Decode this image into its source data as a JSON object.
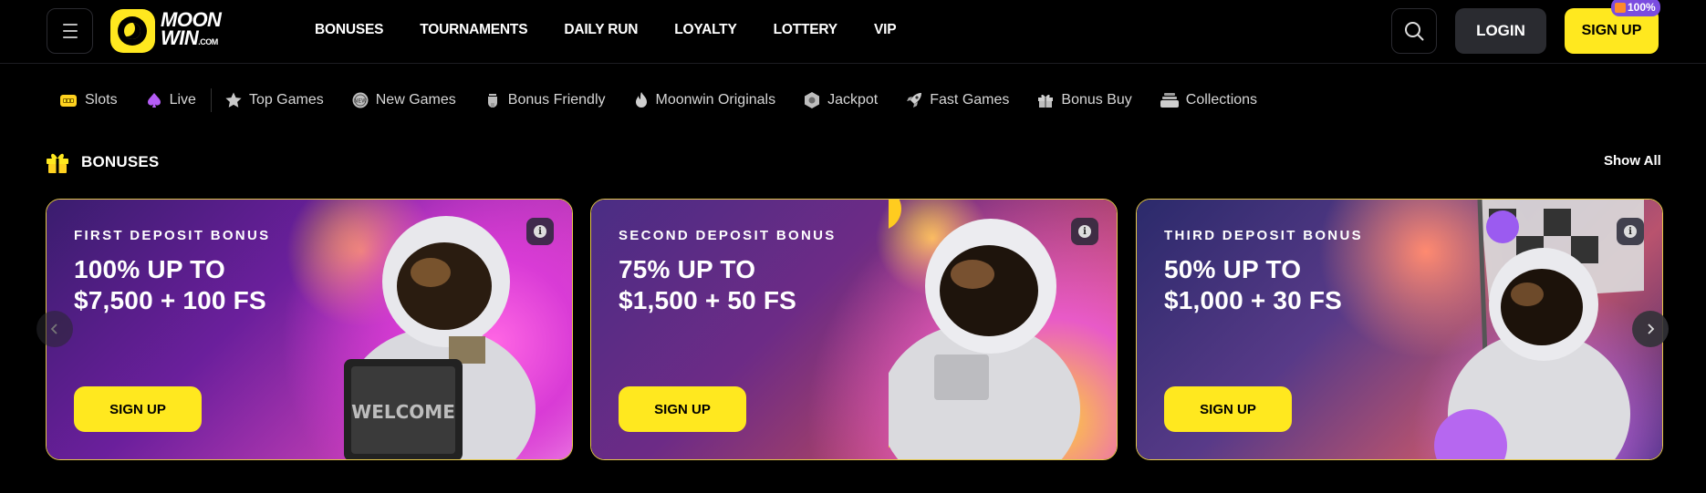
{
  "header": {
    "logo_text_top": "MOON",
    "logo_text_bottom": "WIN",
    "logo_suffix": ".COM",
    "nav": [
      "BONUSES",
      "TOURNAMENTS",
      "DAILY RUN",
      "LOYALTY",
      "LOTTERY",
      "VIP"
    ],
    "login_label": "LOGIN",
    "signup_label": "SIGN UP",
    "signup_badge": "100%"
  },
  "categories": [
    {
      "label": "Slots",
      "icon": "slot-machine-icon"
    },
    {
      "label": "Live",
      "icon": "spade-icon"
    },
    {
      "label": "Top Games",
      "icon": "star-icon"
    },
    {
      "label": "New Games",
      "icon": "new-badge-icon"
    },
    {
      "label": "Bonus Friendly",
      "icon": "trophy-icon"
    },
    {
      "label": "Moonwin Originals",
      "icon": "flame-icon"
    },
    {
      "label": "Jackpot",
      "icon": "jackpot-icon"
    },
    {
      "label": "Fast Games",
      "icon": "rocket-icon"
    },
    {
      "label": "Bonus Buy",
      "icon": "gift-icon"
    },
    {
      "label": "Collections",
      "icon": "stack-icon"
    }
  ],
  "section": {
    "title": "BONUSES",
    "show_all": "Show All"
  },
  "cards": [
    {
      "label": "FIRST DEPOSIT BONUS",
      "title_line1": "100% UP TO",
      "title_line2": "$7,500 + 100 FS",
      "button": "SIGN UP",
      "sign_text": "WELCOME"
    },
    {
      "label": "SECOND DEPOSIT BONUS",
      "title_line1": "75% UP TO",
      "title_line2": "$1,500 + 50 FS",
      "button": "SIGN UP"
    },
    {
      "label": "THIRD DEPOSIT BONUS",
      "title_line1": "50% UP TO",
      "title_line2": "$1,000 + 30 FS",
      "button": "SIGN UP"
    }
  ],
  "colors": {
    "accent": "#ffe81f",
    "background": "#000000",
    "card_border": "#e5c84a",
    "badge": "#7a4ce0"
  }
}
